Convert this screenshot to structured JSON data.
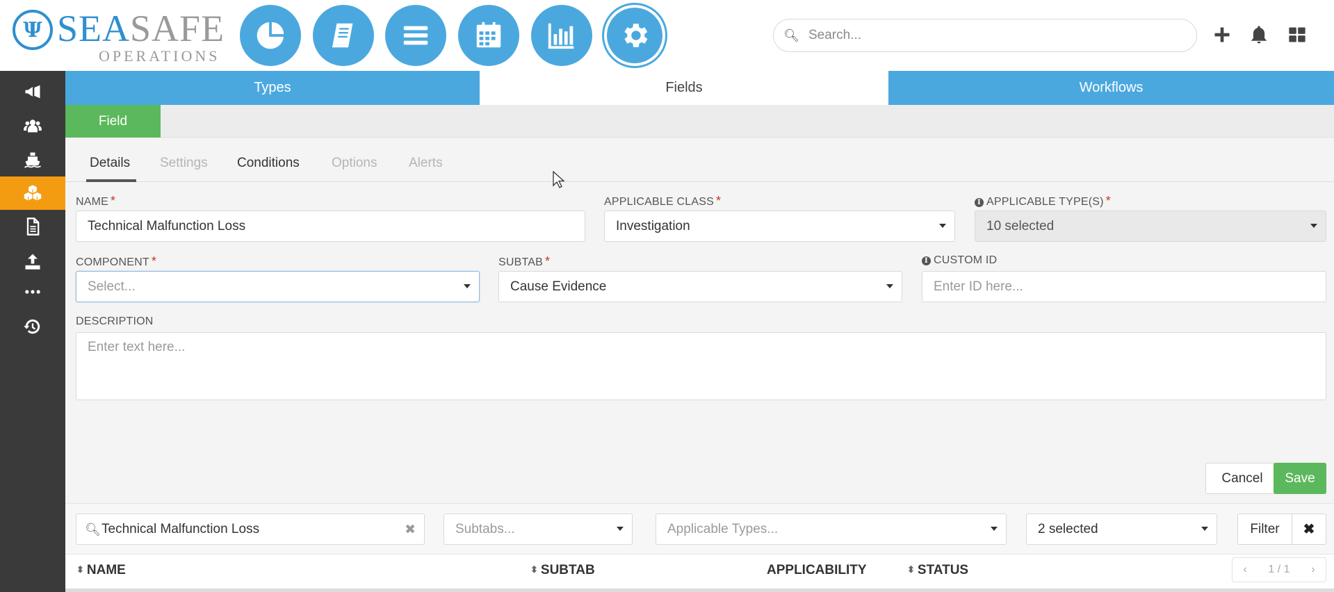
{
  "app": {
    "logo_primary": "SEA",
    "logo_secondary": "SAFE",
    "logo_sub": "OPERATIONS",
    "brand_color": "#4ba8df"
  },
  "header": {
    "nav_icons": [
      "pie-chart-icon",
      "book-icon",
      "list-icon",
      "calendar-icon",
      "bar-chart-icon",
      "gear-icon"
    ],
    "search_placeholder": "Search...",
    "actions": [
      "plus-icon",
      "bell-icon",
      "grid-icon"
    ]
  },
  "sidebar": {
    "items": [
      {
        "icon": "megaphone-icon"
      },
      {
        "icon": "users-icon"
      },
      {
        "icon": "ship-icon"
      },
      {
        "icon": "cubes-icon",
        "active": true
      },
      {
        "icon": "document-icon"
      },
      {
        "icon": "upload-icon"
      },
      {
        "icon": "more-icon"
      },
      {
        "icon": "history-icon"
      }
    ],
    "active_color": "#f39c12"
  },
  "tabs": {
    "types": "Types",
    "fields": "Fields",
    "workflows": "Workflows"
  },
  "field_tab": "Field",
  "detail_tabs": {
    "details": "Details",
    "settings": "Settings",
    "conditions": "Conditions",
    "options": "Options",
    "alerts": "Alerts"
  },
  "form": {
    "name_label": "NAME",
    "name_value": "Technical Malfunction Loss",
    "class_label": "APPLICABLE CLASS",
    "class_value": "Investigation",
    "types_label": "APPLICABLE TYPE(S)",
    "types_value": "10 selected",
    "component_label": "COMPONENT",
    "component_placeholder": "Select...",
    "subtab_label": "SUBTAB",
    "subtab_value": "Cause Evidence",
    "custom_id_label": "CUSTOM ID",
    "custom_id_placeholder": "Enter ID here...",
    "description_label": "DESCRIPTION",
    "description_placeholder": "Enter text here...",
    "required_marker": "*"
  },
  "actions": {
    "cancel": "Cancel",
    "save": "Save"
  },
  "filters": {
    "search_value": "Technical Malfunction Loss",
    "subtabs_placeholder": "Subtabs...",
    "types_placeholder": "Applicable Types...",
    "status_value": "2 selected",
    "filter_label": "Filter",
    "clear_label": "✖"
  },
  "table": {
    "columns": [
      "NAME",
      "SUBTAB",
      "APPLICABILITY",
      "STATUS"
    ],
    "pager_prev": "‹",
    "pager_text": "1 / 1",
    "pager_next": "›"
  }
}
